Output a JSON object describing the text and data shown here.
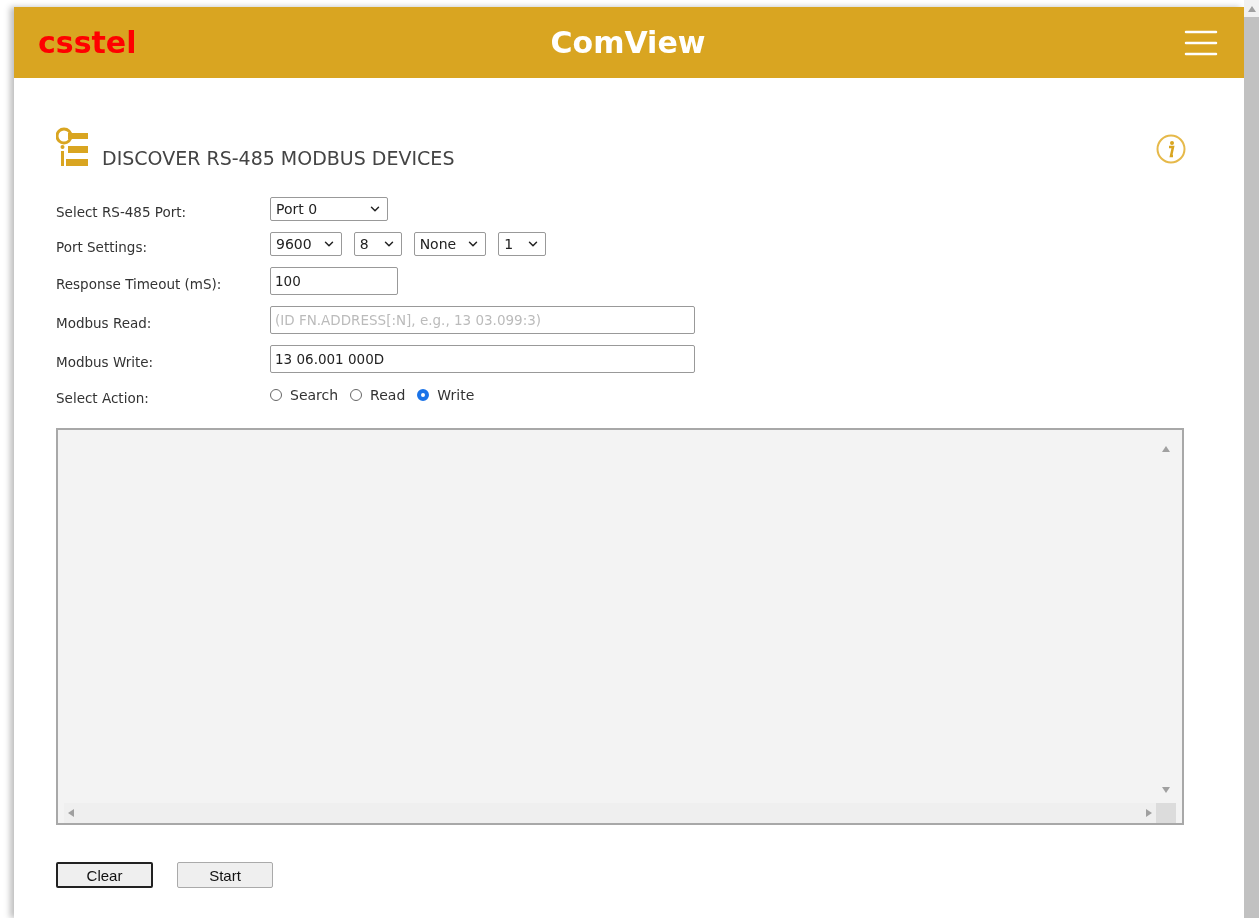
{
  "header": {
    "logo": "csstel",
    "title": "ComView"
  },
  "section": {
    "title": "DISCOVER RS-485 MODBUS DEVICES"
  },
  "form": [
    {
      "kind": "selects",
      "label": "Select RS-485 Port:",
      "selects": [
        "Port 0"
      ]
    },
    {
      "kind": "selects",
      "label": "Port Settings:",
      "selects": [
        "9600",
        "8",
        "None",
        "1"
      ]
    },
    {
      "kind": "number-input",
      "label": "Response Timeout (mS):",
      "value": "100"
    },
    {
      "kind": "text-input",
      "label": "Modbus Read:",
      "placeholder": "(ID FN.ADDRESS[:N], e.g., 13 03.099:3)"
    },
    {
      "kind": "text-input",
      "label": "Modbus Write:",
      "value": "13 06.001 000D"
    },
    {
      "kind": "radios",
      "label": "Select Action:",
      "options": [
        {
          "label": "Search",
          "selected": false
        },
        {
          "label": "Read",
          "selected": false
        },
        {
          "label": "Write",
          "selected": true
        }
      ]
    }
  ],
  "buttons": [
    {
      "label": "Clear",
      "focused": true
    },
    {
      "label": "Start",
      "focused": false
    }
  ]
}
